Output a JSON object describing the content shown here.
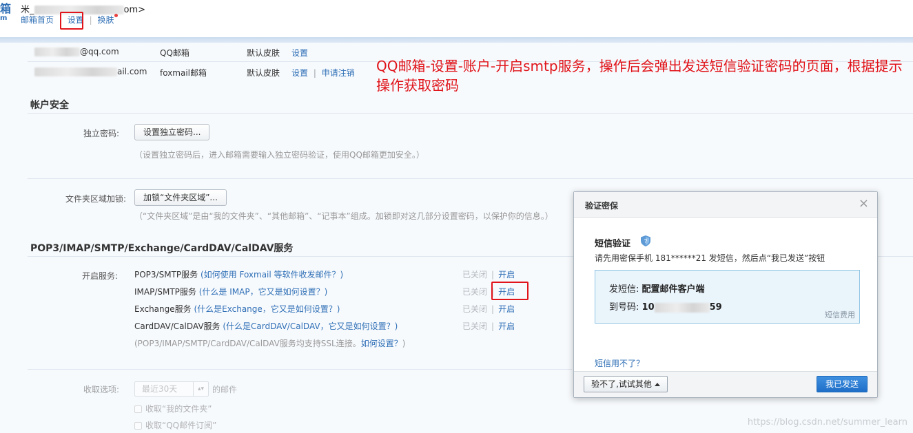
{
  "header": {
    "logo_text": "箱",
    "logo_sub": "m",
    "user_prefix": "米_",
    "user_suffix": "om>",
    "nav": [
      {
        "label": "邮箱首页"
      },
      {
        "label": "设置"
      },
      {
        "label": "换肤"
      }
    ]
  },
  "accounts": [
    {
      "email_suffix": "@qq.com",
      "type": "QQ邮箱",
      "skin": "默认皮肤",
      "action": "设置",
      "action2": ""
    },
    {
      "email_suffix": "ail.com",
      "type": "foxmail邮箱",
      "skin": "默认皮肤",
      "action": "设置",
      "action2": "申请注销"
    }
  ],
  "security": {
    "title": "帐户安全",
    "password_label": "独立密码:",
    "password_button": "设置独立密码...",
    "password_hint": "（设置独立密码后，进入邮箱需要输入独立密码验证，使用QQ邮箱更加安全。）",
    "folder_label": "文件夹区域加锁:",
    "folder_button": "加锁“文件夹区域”...",
    "folder_hint": "（“文件夹区域”是由“我的文件夹”、“其他邮箱”、“记事本”组成。加锁即对这几部分设置密码，以保护你的信息。）"
  },
  "protocols": {
    "title": "POP3/IMAP/SMTP/Exchange/CardDAV/CalDAV服务",
    "label": "开启服务:",
    "services": [
      {
        "name": "POP3/SMTP服务",
        "help": "(如何使用 Foxmail 等软件收发邮件？)",
        "status": "已关闭",
        "action": "开启"
      },
      {
        "name": "IMAP/SMTP服务",
        "help": "(什么是 IMAP，它又是如何设置？)",
        "status": "已关闭",
        "action": "开启"
      },
      {
        "name": "Exchange服务",
        "help": "(什么是Exchange，它又是如何设置？)",
        "status": "已关闭",
        "action": "开启"
      },
      {
        "name": "CardDAV/CalDAV服务",
        "help": "(什么是CardDAV/CalDAV，它又是如何设置？)",
        "status": "已关闭",
        "action": "开启"
      }
    ],
    "ssl_note_prefix": "(POP3/IMAP/SMTP/CardDAV/CalDAV服务均支持SSL连接。",
    "ssl_note_link": "如何设置？",
    "ssl_note_suffix": ")"
  },
  "receive": {
    "label": "收取选项:",
    "select_value": "最近30天",
    "select_suffix": "的邮件",
    "checkbox1": "收取“我的文件夹”",
    "checkbox2": "收取“QQ邮件订阅”"
  },
  "annotation": "QQ邮箱-设置-账户-开启smtp服务，操作后会弹出发送短信验证密码的页面，根据提示操作获取密码",
  "dialog": {
    "title": "验证密保",
    "close": "×",
    "heading": "短信验证",
    "instruction": "请先用密保手机 181******21 发短信，然后点“我已发送”按钮",
    "sms_content_label": "发短信:",
    "sms_content_value": "配置邮件客户端",
    "sms_to_label": "到号码:",
    "sms_to_prefix": "10",
    "sms_to_suffix": "59",
    "fee_link": "短信费用",
    "help_link": "短信用不了？",
    "alt_button": "验不了,试试其他",
    "primary_button": "我已发送"
  },
  "watermark": "https://blog.csdn.net/summer_learn",
  "colors": {
    "link": "#2f6fb6",
    "annotation_red": "#e0141a",
    "primary": "#1f6fc8"
  }
}
